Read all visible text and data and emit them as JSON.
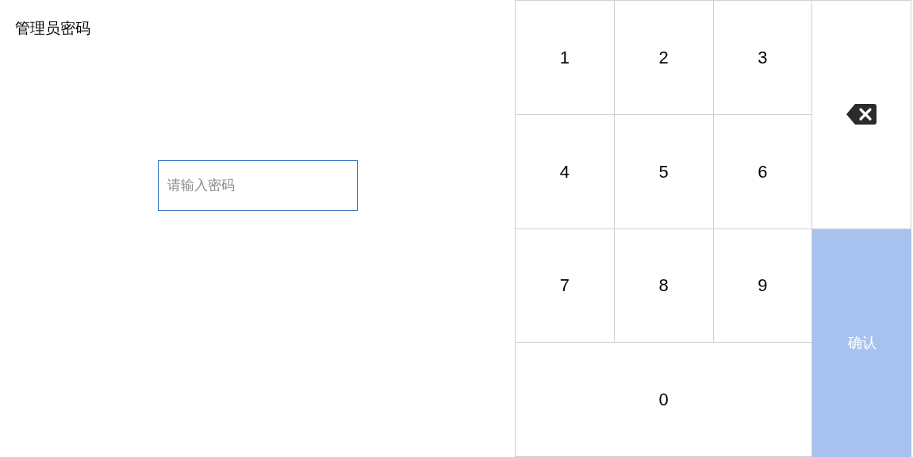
{
  "title": "管理员密码",
  "password_field": {
    "placeholder": "请输入密码"
  },
  "keypad": [
    {
      "kind": "digit",
      "label": "1"
    },
    {
      "kind": "digit",
      "label": "2"
    },
    {
      "kind": "digit",
      "label": "3"
    },
    {
      "kind": "backspace"
    },
    {
      "kind": "digit",
      "label": "4"
    },
    {
      "kind": "digit",
      "label": "5"
    },
    {
      "kind": "digit",
      "label": "6"
    },
    {
      "kind": "digit",
      "label": "7"
    },
    {
      "kind": "digit",
      "label": "8"
    },
    {
      "kind": "digit",
      "label": "9"
    },
    {
      "kind": "confirm",
      "label": "确认",
      "disabled": true
    },
    {
      "kind": "digit",
      "label": "0"
    }
  ]
}
